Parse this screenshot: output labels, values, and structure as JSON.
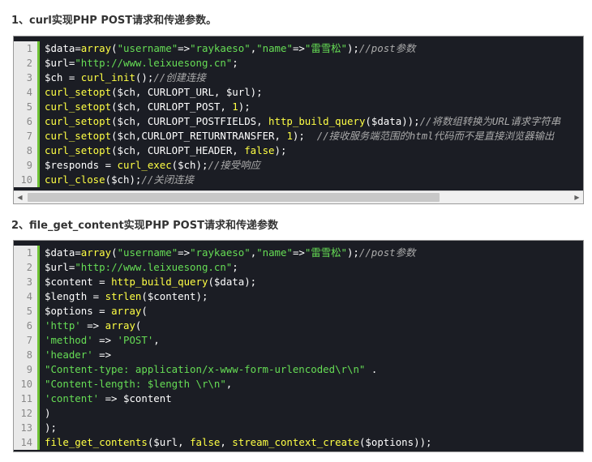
{
  "sections": [
    {
      "heading": "1、curl实现PHP POST请求和传递参数。",
      "lines": [
        {
          "num": "1",
          "tokens": [
            [
              "var",
              "$data"
            ],
            [
              "op",
              "="
            ],
            [
              "fn",
              "array"
            ],
            [
              "op",
              "("
            ],
            [
              "str",
              "\"username\""
            ],
            [
              "op",
              "=>"
            ],
            [
              "str",
              "\"raykaeso\""
            ],
            [
              "op",
              ","
            ],
            [
              "str",
              "\"name\""
            ],
            [
              "op",
              "=>"
            ],
            [
              "str",
              "\"雷雪松\""
            ],
            [
              "op",
              ");"
            ],
            [
              "cm",
              "//post参数"
            ]
          ]
        },
        {
          "num": "2",
          "tokens": [
            [
              "var",
              "$url"
            ],
            [
              "op",
              "="
            ],
            [
              "str",
              "\"http://www.leixuesong.cn\""
            ],
            [
              "op",
              ";"
            ]
          ]
        },
        {
          "num": "3",
          "tokens": [
            [
              "var",
              "$ch"
            ],
            [
              "op",
              " = "
            ],
            [
              "fn",
              "curl_init"
            ],
            [
              "op",
              "();"
            ],
            [
              "cm",
              "//创建连接"
            ]
          ]
        },
        {
          "num": "4",
          "tokens": [
            [
              "fn",
              "curl_setopt"
            ],
            [
              "op",
              "("
            ],
            [
              "var",
              "$ch"
            ],
            [
              "op",
              ", "
            ],
            [
              "cst",
              "CURLOPT_URL"
            ],
            [
              "op",
              ", "
            ],
            [
              "var",
              "$url"
            ],
            [
              "op",
              ");"
            ]
          ]
        },
        {
          "num": "5",
          "tokens": [
            [
              "fn",
              "curl_setopt"
            ],
            [
              "op",
              "("
            ],
            [
              "var",
              "$ch"
            ],
            [
              "op",
              ", "
            ],
            [
              "cst",
              "CURLOPT_POST"
            ],
            [
              "op",
              ", "
            ],
            [
              "kw",
              "1"
            ],
            [
              "op",
              ");"
            ]
          ]
        },
        {
          "num": "6",
          "tokens": [
            [
              "fn",
              "curl_setopt"
            ],
            [
              "op",
              "("
            ],
            [
              "var",
              "$ch"
            ],
            [
              "op",
              ", "
            ],
            [
              "cst",
              "CURLOPT_POSTFIELDS"
            ],
            [
              "op",
              ", "
            ],
            [
              "fn",
              "http_build_query"
            ],
            [
              "op",
              "("
            ],
            [
              "var",
              "$data"
            ],
            [
              "op",
              "));"
            ],
            [
              "cm",
              "//将数组转换为URL请求字符串"
            ]
          ]
        },
        {
          "num": "7",
          "tokens": [
            [
              "fn",
              "curl_setopt"
            ],
            [
              "op",
              "("
            ],
            [
              "var",
              "$ch"
            ],
            [
              "op",
              ","
            ],
            [
              "cst",
              "CURLOPT_RETURNTRANSFER"
            ],
            [
              "op",
              ", "
            ],
            [
              "kw",
              "1"
            ],
            [
              "op",
              ");  "
            ],
            [
              "cm",
              "//接收服务端范围的html代码而不是直接浏览器输出"
            ]
          ]
        },
        {
          "num": "8",
          "tokens": [
            [
              "fn",
              "curl_setopt"
            ],
            [
              "op",
              "("
            ],
            [
              "var",
              "$ch"
            ],
            [
              "op",
              ", "
            ],
            [
              "cst",
              "CURLOPT_HEADER"
            ],
            [
              "op",
              ", "
            ],
            [
              "kw",
              "false"
            ],
            [
              "op",
              ");"
            ]
          ]
        },
        {
          "num": "9",
          "tokens": [
            [
              "var",
              "$responds"
            ],
            [
              "op",
              " = "
            ],
            [
              "fn",
              "curl_exec"
            ],
            [
              "op",
              "("
            ],
            [
              "var",
              "$ch"
            ],
            [
              "op",
              ");"
            ],
            [
              "cm",
              "//接受响应"
            ]
          ]
        },
        {
          "num": "10",
          "tokens": [
            [
              "fn",
              "curl_close"
            ],
            [
              "op",
              "("
            ],
            [
              "var",
              "$ch"
            ],
            [
              "op",
              ");"
            ],
            [
              "cm",
              "//关闭连接"
            ]
          ]
        }
      ]
    },
    {
      "heading": "2、file_get_content实现PHP POST请求和传递参数",
      "lines": [
        {
          "num": "1",
          "tokens": [
            [
              "var",
              "$data"
            ],
            [
              "op",
              "="
            ],
            [
              "fn",
              "array"
            ],
            [
              "op",
              "("
            ],
            [
              "str",
              "\"username\""
            ],
            [
              "op",
              "=>"
            ],
            [
              "str",
              "\"raykaeso\""
            ],
            [
              "op",
              ","
            ],
            [
              "str",
              "\"name\""
            ],
            [
              "op",
              "=>"
            ],
            [
              "str",
              "\"雷雪松\""
            ],
            [
              "op",
              ");"
            ],
            [
              "cm",
              "//post参数"
            ]
          ]
        },
        {
          "num": "2",
          "tokens": [
            [
              "var",
              "$url"
            ],
            [
              "op",
              "="
            ],
            [
              "str",
              "\"http://www.leixuesong.cn\""
            ],
            [
              "op",
              ";"
            ]
          ]
        },
        {
          "num": "3",
          "tokens": [
            [
              "var",
              "$content"
            ],
            [
              "op",
              " = "
            ],
            [
              "fn",
              "http_build_query"
            ],
            [
              "op",
              "("
            ],
            [
              "var",
              "$data"
            ],
            [
              "op",
              ");"
            ]
          ]
        },
        {
          "num": "4",
          "tokens": [
            [
              "var",
              "$length"
            ],
            [
              "op",
              " = "
            ],
            [
              "fn",
              "strlen"
            ],
            [
              "op",
              "("
            ],
            [
              "var",
              "$content"
            ],
            [
              "op",
              ");"
            ]
          ]
        },
        {
          "num": "5",
          "tokens": [
            [
              "var",
              "$options"
            ],
            [
              "op",
              " = "
            ],
            [
              "fn",
              "array"
            ],
            [
              "op",
              "("
            ]
          ]
        },
        {
          "num": "6",
          "tokens": [
            [
              "str",
              "'http'"
            ],
            [
              "op",
              " => "
            ],
            [
              "fn",
              "array"
            ],
            [
              "op",
              "("
            ]
          ]
        },
        {
          "num": "7",
          "tokens": [
            [
              "str",
              "'method'"
            ],
            [
              "op",
              " => "
            ],
            [
              "str",
              "'POST'"
            ],
            [
              "op",
              ","
            ]
          ]
        },
        {
          "num": "8",
          "tokens": [
            [
              "str",
              "'header'"
            ],
            [
              "op",
              " =>"
            ]
          ]
        },
        {
          "num": "9",
          "tokens": [
            [
              "str",
              "\"Content-type: application/x-www-form-urlencoded\\r\\n\""
            ],
            [
              "op",
              " ."
            ]
          ]
        },
        {
          "num": "10",
          "tokens": [
            [
              "str",
              "\"Content-length: $length \\r\\n\""
            ],
            [
              "op",
              ","
            ]
          ]
        },
        {
          "num": "11",
          "tokens": [
            [
              "str",
              "'content'"
            ],
            [
              "op",
              " => "
            ],
            [
              "var",
              "$content"
            ]
          ]
        },
        {
          "num": "12",
          "tokens": [
            [
              "op",
              ")"
            ]
          ]
        },
        {
          "num": "13",
          "tokens": [
            [
              "op",
              ");"
            ]
          ]
        },
        {
          "num": "14",
          "tokens": [
            [
              "fn",
              "file_get_contents"
            ],
            [
              "op",
              "("
            ],
            [
              "var",
              "$url"
            ],
            [
              "op",
              ", "
            ],
            [
              "kw",
              "false"
            ],
            [
              "op",
              ", "
            ],
            [
              "fn",
              "stream_context_create"
            ],
            [
              "op",
              "("
            ],
            [
              "var",
              "$options"
            ],
            [
              "op",
              "));"
            ]
          ]
        }
      ]
    }
  ],
  "scrollbar": {
    "left_arrow_icon": "triangle-left-icon",
    "right_arrow_icon": "triangle-right-icon",
    "left_glyph": "◀",
    "right_glyph": "▶"
  },
  "colors": {
    "code_bg": "#1b1d24",
    "gutter_bg": "#e9e9e9",
    "gutter_accent": "#6ec234",
    "string": "#66dd55",
    "function": "#ffff44",
    "comment": "#aaaaaa"
  }
}
